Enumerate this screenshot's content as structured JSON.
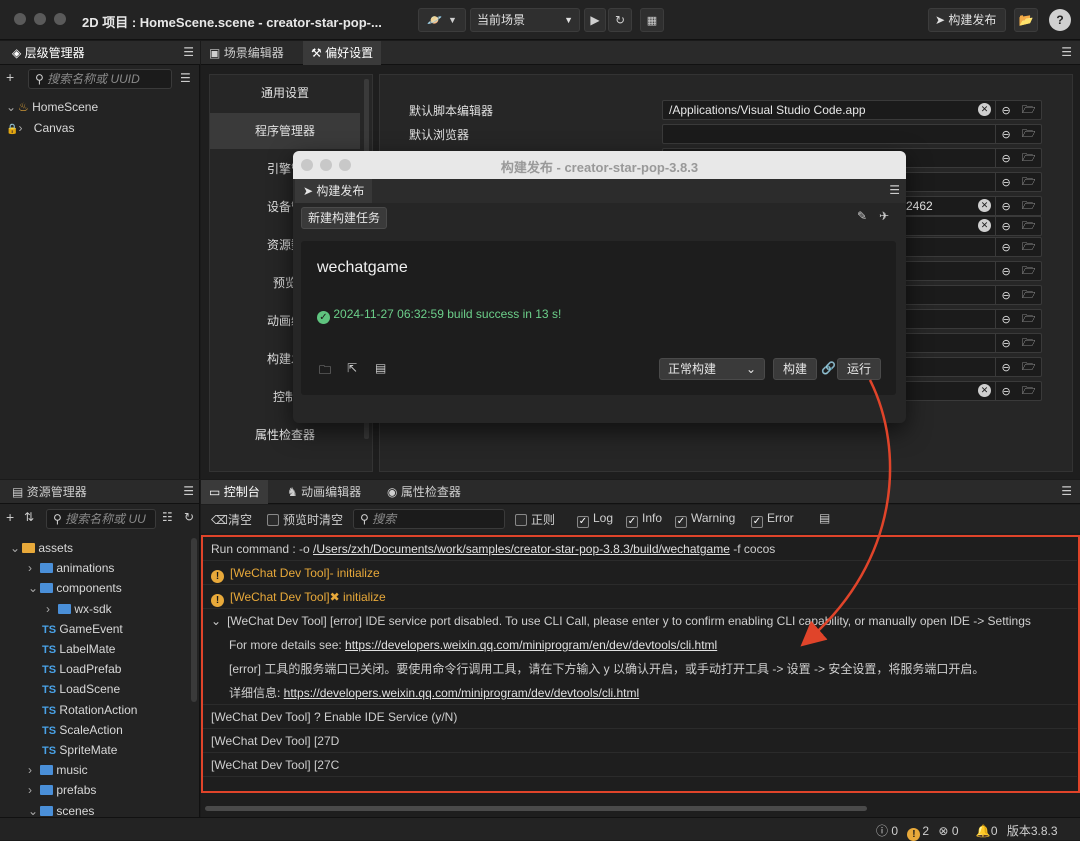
{
  "titlebar": {
    "app_title": "2D 项目 : HomeScene.scene - creator-star-pop-...",
    "scene_select": "当前场景",
    "build_publish": "构建发布"
  },
  "hierarchy": {
    "tab": "层级管理器",
    "search_placeholder": "搜索名称或 UUID",
    "items": [
      "HomeScene",
      "Canvas"
    ]
  },
  "center_tabs": {
    "scene_editor": "场景编辑器",
    "preferences": "偏好设置"
  },
  "prefs_menu": [
    "通用设置",
    "程序管理器",
    "引擎管",
    "设备管",
    "资源数",
    "预览",
    "动画编",
    "构建发",
    "控制",
    "属性检查器"
  ],
  "prefs_fields": {
    "script_editor_label": "默认脚本编辑器",
    "script_editor_value": "/Applications/Visual Studio Code.app",
    "browser_label": "默认浏览器",
    "port_fragment": "2462"
  },
  "build_dialog": {
    "title": "构建发布 - creator-star-pop-3.8.3",
    "tab": "构建发布",
    "new_task": "新建构建任务",
    "platform": "wechatgame",
    "status": "2024-11-27 06:32:59 build success in 13 s!",
    "build_mode": "正常构建",
    "build_btn": "构建",
    "run_btn": "运行"
  },
  "assets": {
    "tab": "资源管理器",
    "search_placeholder": "搜索名称或 UU",
    "tree": [
      {
        "label": "assets",
        "type": "db",
        "indent": 0,
        "open": true
      },
      {
        "label": "animations",
        "type": "folder",
        "indent": 1,
        "open": false
      },
      {
        "label": "components",
        "type": "folder",
        "indent": 1,
        "open": true
      },
      {
        "label": "wx-sdk",
        "type": "folder",
        "indent": 2,
        "open": false
      },
      {
        "label": "GameEvent",
        "type": "ts",
        "indent": 2
      },
      {
        "label": "LabelMate",
        "type": "ts",
        "indent": 2
      },
      {
        "label": "LoadPrefab",
        "type": "ts",
        "indent": 2
      },
      {
        "label": "LoadScene",
        "type": "ts",
        "indent": 2
      },
      {
        "label": "RotationAction",
        "type": "ts",
        "indent": 2
      },
      {
        "label": "ScaleAction",
        "type": "ts",
        "indent": 2
      },
      {
        "label": "SpriteMate",
        "type": "ts",
        "indent": 2
      },
      {
        "label": "music",
        "type": "folder",
        "indent": 1,
        "open": false
      },
      {
        "label": "prefabs",
        "type": "folder",
        "indent": 1,
        "open": false
      },
      {
        "label": "scenes",
        "type": "folder",
        "indent": 1,
        "open": true
      }
    ]
  },
  "console": {
    "tabs": [
      "控制台",
      "动画编辑器",
      "属性检查器"
    ],
    "clear": "清空",
    "preview_clear": "预览时清空",
    "search_placeholder": "搜索",
    "regex": "正则",
    "log": "Log",
    "info": "Info",
    "warning": "Warning",
    "error": "Error",
    "lines": {
      "cmd_prefix": "Run command : -o ",
      "cmd_path": "/Users/zxh/Documents/work/samples/creator-star-pop-3.8.3/build/wechatgame",
      "cmd_suffix": " -f cocos",
      "warn1": "[WeChat Dev Tool]- initialize",
      "warn2": "[WeChat Dev Tool]✖ initialize",
      "error_head": "[WeChat Dev Tool] [error] IDE service port disabled. To use CLI Call, please enter y to confirm enabling CLI capability, or manually open IDE -> Settings",
      "details_prefix": "For more details see: ",
      "details_link": "https://developers.weixin.qq.com/miniprogram/en/dev/devtools/cli.html",
      "error_cn": "[error] 工具的服务端口已关闭。要使用命令行调用工具，请在下方输入 y 以确认开启，或手动打开工具 -> 设置 -> 安全设置，将服务端口开启。",
      "details_cn_prefix": "详细信息: ",
      "details_cn_link": "https://developers.weixin.qq.com/miniprogram/dev/devtools/cli.html",
      "enable": "[WeChat Dev Tool] ? Enable IDE Service (y/N)",
      "code1": "[WeChat Dev Tool]  [27D",
      "code2": "[WeChat Dev Tool]  [27C"
    }
  },
  "statusbar": {
    "info": "0",
    "warn": "2",
    "error": "0",
    "notify": "0",
    "version": "版本3.8.3"
  }
}
